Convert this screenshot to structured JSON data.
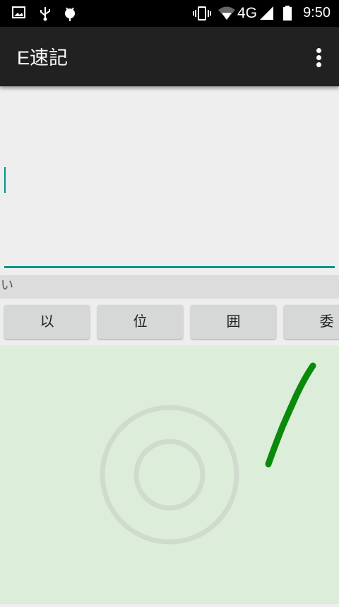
{
  "status_bar": {
    "time": "9:50",
    "network": "4G",
    "icons": [
      "image-icon",
      "usb-icon",
      "android-icon",
      "vibrate-icon",
      "wifi-icon",
      "signal-icon",
      "battery-icon"
    ]
  },
  "app_bar": {
    "title": "E速記",
    "menu_icon": "more-vert-icon"
  },
  "editor": {
    "value": "",
    "accent": "#009688"
  },
  "reading": {
    "text": "い"
  },
  "candidates": [
    "以",
    "位",
    "囲",
    "委"
  ],
  "handwriting_pad": {
    "background": "#dcedda",
    "stroke_color": "#0a8a0a"
  }
}
